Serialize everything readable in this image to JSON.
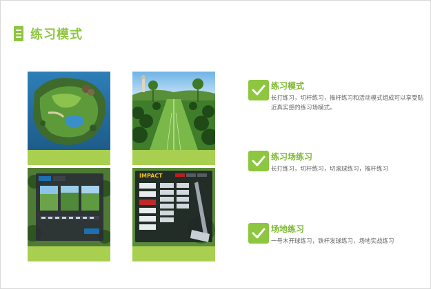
{
  "header": {
    "title": "练习模式"
  },
  "features": [
    {
      "title": "练习模式",
      "desc": "长打练习，切杆练习，推杆练习和活动模式组成可以享受贴近真实感的练习场模式。"
    },
    {
      "title": "练习场练习",
      "desc": "长打练习，切杆练习，切滚球练习，推杆练习"
    },
    {
      "title": "场地练习",
      "desc": "一号木开球练习，铁杆发球练习，场地实战练习"
    }
  ],
  "screens": {
    "menu_screen": {
      "brand": "IMPACT"
    }
  },
  "colors": {
    "accent": "#8dc63f",
    "bar": "#a8cf4f",
    "text": "#666666"
  }
}
